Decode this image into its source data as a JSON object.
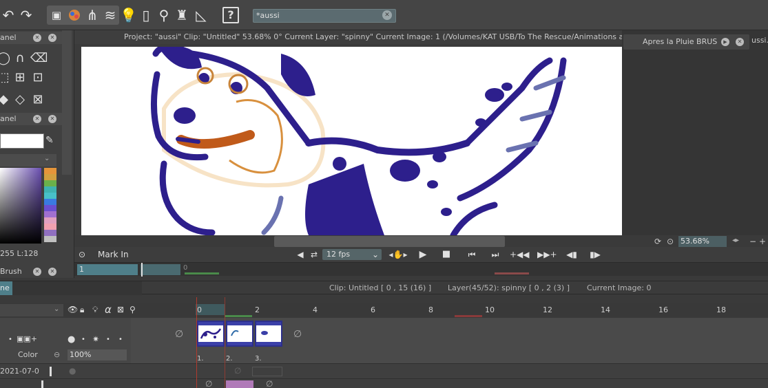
{
  "toolbar": {
    "search_value": "*aussi",
    "help_label": "?"
  },
  "left_panel": {
    "panel_label_1": "anel",
    "panel_label_2": "anel",
    "hsl_readout": "255 L:128",
    "brush_label": "Brush"
  },
  "infobar": {
    "text": "Project: \"aussi\"  Clip: \"Untitled\"   53.68%   0°  Current Layer: \"spinny\"  Current Image: 1 (/Volumes/KAT USB/To The Rescue/Animations and A"
  },
  "palette": {
    "name": "Apres la Pluie BRUS",
    "file_peek": "ussi.t"
  },
  "view": {
    "zoom": "53.68%"
  },
  "transport": {
    "mark_in": "Mark In",
    "fps": "12 fps"
  },
  "mini_timeline": {
    "start": "1",
    "marker": "0"
  },
  "timeline": {
    "tab_label": "ne",
    "clip_status": "Clip: Untitled [ 0 , 15  (16) ]",
    "layer_status": "Layer(45/52): spinny [ 0 , 2  (3) ]",
    "image_status": "Current Image: 0",
    "ruler": [
      "0",
      "2",
      "4",
      "6",
      "8",
      "10",
      "12",
      "14",
      "16",
      "18"
    ],
    "layer_blend": "Color",
    "layer_opacity": "100%",
    "cels": [
      "1.",
      "2.",
      "3."
    ],
    "row2_label": "2021-07-0"
  },
  "colors": {
    "accent": "#4f7f8a",
    "drawing_ink": "#2d1f8c",
    "drawing_orange": "#d0702a"
  }
}
